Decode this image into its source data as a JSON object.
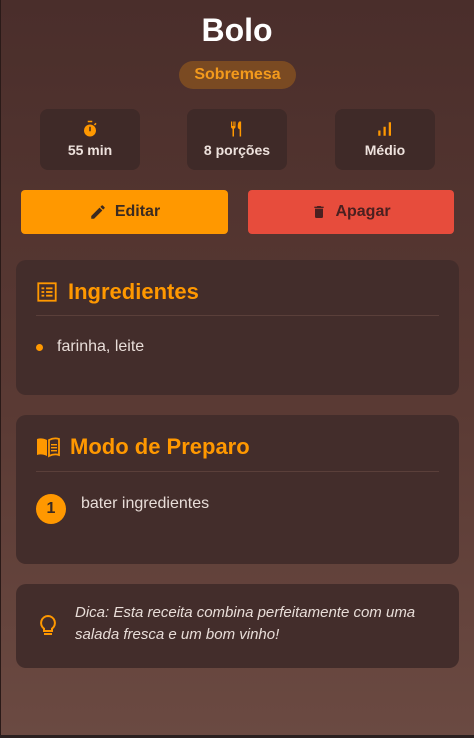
{
  "recipe": {
    "title": "Bolo",
    "category": "Sobremesa"
  },
  "stats": [
    {
      "icon": "timer-icon",
      "label": "55 min"
    },
    {
      "icon": "utensils-icon",
      "label": "8 porções"
    },
    {
      "icon": "signal-bars-icon",
      "label": "Médio"
    }
  ],
  "actions": {
    "edit_label": "Editar",
    "delete_label": "Apagar"
  },
  "ingredients": {
    "heading": "Ingredientes",
    "items": [
      "farinha, leite"
    ]
  },
  "preparation": {
    "heading": "Modo de Preparo",
    "steps": [
      {
        "number": "1",
        "text": "bater ingredientes"
      }
    ]
  },
  "tip": {
    "text": "Dica: Esta receita combina perfeitamente com uma salada fresca e um bom vinho!"
  },
  "colors": {
    "accent": "#ff9800",
    "danger": "#e74c3c",
    "card_bg": "#432d2b",
    "page_bg": "#4a2e2b"
  }
}
